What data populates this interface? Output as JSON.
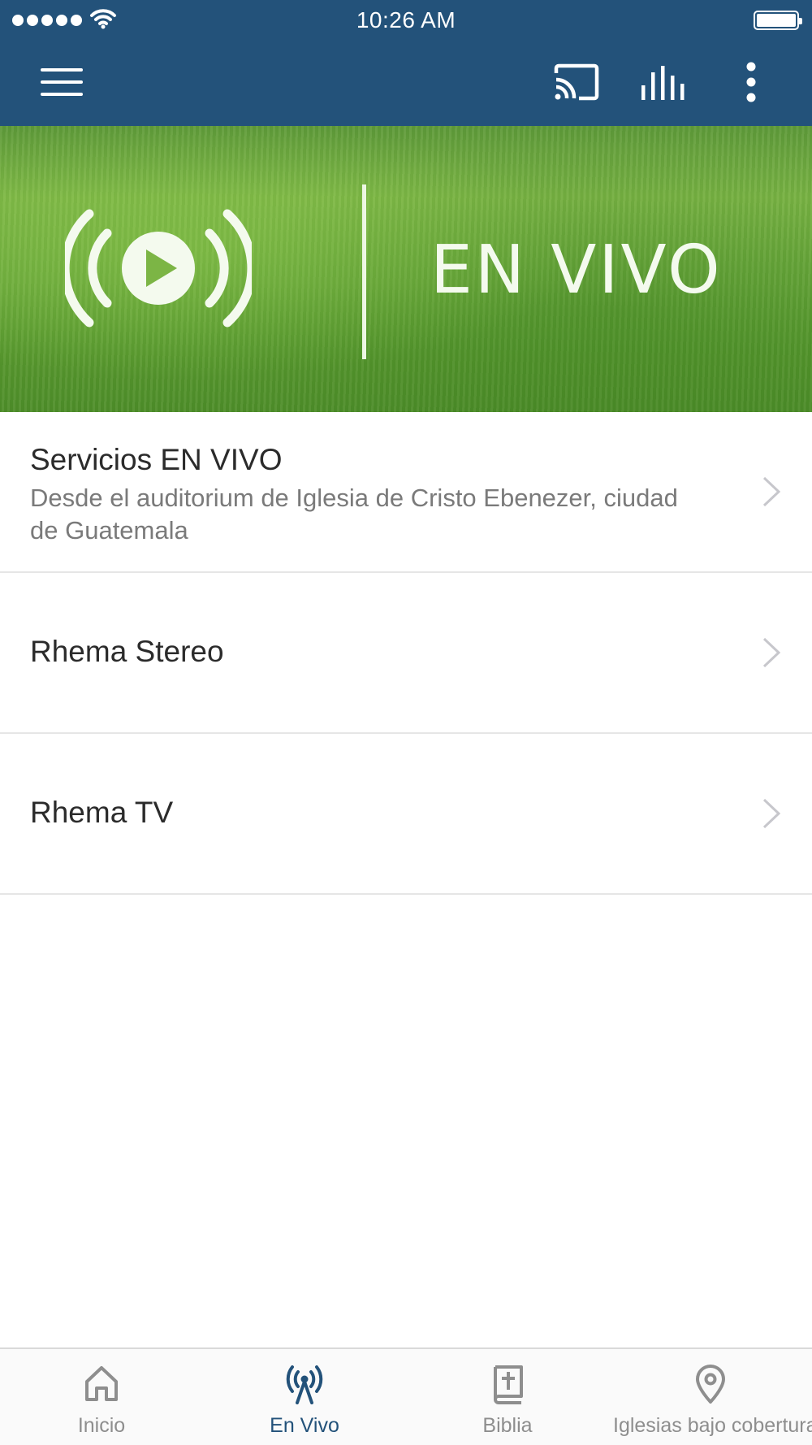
{
  "status_bar": {
    "time": "10:26 AM"
  },
  "app_bar": {
    "menu_icon": "hamburger-menu-icon",
    "cast_icon": "cast-icon",
    "equalizer_icon": "equalizer-icon",
    "more_icon": "more-vertical-icon"
  },
  "banner": {
    "title": "EN VIVO",
    "icon": "live-broadcast-play-icon"
  },
  "list": {
    "items": [
      {
        "title": "Servicios EN VIVO",
        "subtitle": "Desde el auditorium de Iglesia de Cristo Ebenezer, ciudad de Guatemala"
      },
      {
        "title": "Rhema Stereo"
      },
      {
        "title": "Rhema TV"
      }
    ]
  },
  "tab_bar": {
    "active": "En Vivo",
    "tabs": [
      {
        "label": "Inicio",
        "icon": "home-icon"
      },
      {
        "label": "En Vivo",
        "icon": "broadcast-antenna-icon"
      },
      {
        "label": "Biblia",
        "icon": "bible-icon"
      },
      {
        "label": "Iglesias bajo cobertura",
        "icon": "location-pin-icon"
      }
    ]
  },
  "colors": {
    "primary": "#23527a",
    "inactive_tab": "#8e8e8e",
    "banner_green": "#6aa83b"
  }
}
